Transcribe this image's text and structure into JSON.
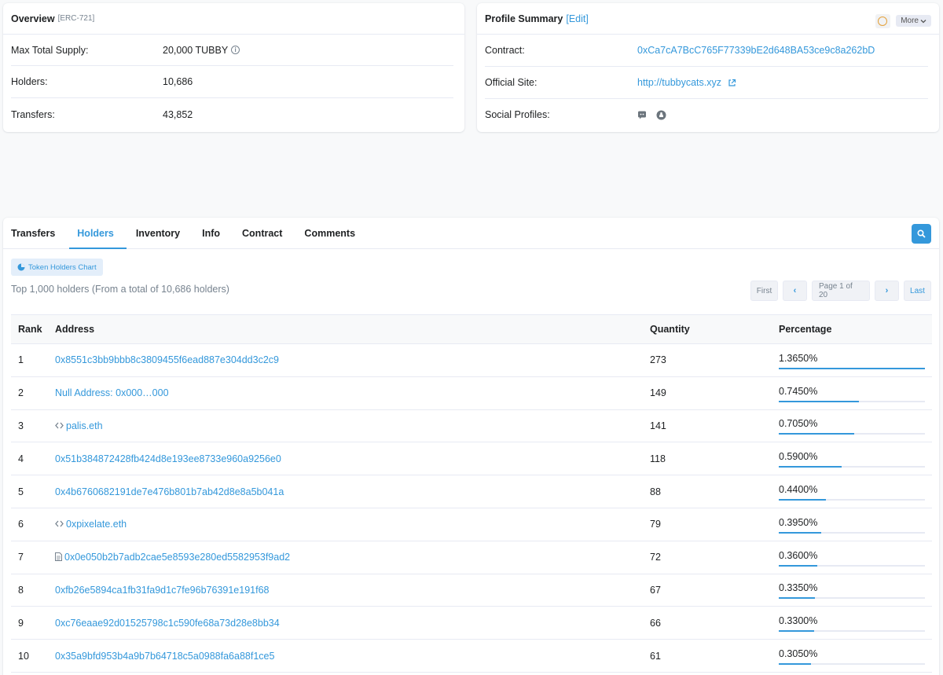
{
  "overview": {
    "title": "Overview",
    "standard": "[ERC-721]",
    "rows": [
      {
        "label": "Max Total Supply:",
        "value": "20,000 TUBBY"
      },
      {
        "label": "Holders:",
        "value": "10,686"
      },
      {
        "label": "Transfers:",
        "value": "43,852"
      }
    ]
  },
  "profile": {
    "title": "Profile Summary",
    "edit": "[Edit]",
    "more": "More",
    "rows": [
      {
        "label": "Contract:",
        "value": "0xCa7cA7BcC765F77339bE2d648BA53ce9c8a262bD"
      },
      {
        "label": "Official Site:",
        "value": "http://tubbycats.xyz"
      },
      {
        "label": "Social Profiles:",
        "value": ""
      }
    ],
    "social_icons": [
      "discord-icon",
      "github-icon"
    ]
  },
  "tabs": [
    "Transfers",
    "Holders",
    "Inventory",
    "Info",
    "Contract",
    "Comments"
  ],
  "active_tab": "Holders",
  "chart_button": "Token Holders Chart",
  "summary": "Top 1,000 holders (From a total of 10,686 holders)",
  "pager": {
    "first": "First",
    "prev": "‹",
    "page": "Page 1 of 20",
    "next": "›",
    "last": "Last"
  },
  "columns": [
    "Rank",
    "Address",
    "Quantity",
    "Percentage"
  ],
  "holders": [
    {
      "rank": "1",
      "address": "0x8551c3bb9bbb8c3809455f6ead887e304dd3c2c9",
      "icon": "",
      "qty": "273",
      "pct": "1.3650%",
      "fill": 1.0
    },
    {
      "rank": "2",
      "address": "Null Address: 0x000…000",
      "icon": "",
      "qty": "149",
      "pct": "0.7450%",
      "fill": 0.546
    },
    {
      "rank": "3",
      "address": "palis.eth",
      "icon": "ens-icon",
      "qty": "141",
      "pct": "0.7050%",
      "fill": 0.516
    },
    {
      "rank": "4",
      "address": "0x51b384872428fb424d8e193ee8733e960a9256e0",
      "icon": "",
      "qty": "118",
      "pct": "0.5900%",
      "fill": 0.432
    },
    {
      "rank": "5",
      "address": "0x4b6760682191de7e476b801b7ab42d8e8a5b041a",
      "icon": "",
      "qty": "88",
      "pct": "0.4400%",
      "fill": 0.322
    },
    {
      "rank": "6",
      "address": "0xpixelate.eth",
      "icon": "ens-icon",
      "qty": "79",
      "pct": "0.3950%",
      "fill": 0.289
    },
    {
      "rank": "7",
      "address": "0x0e050b2b7adb2cae5e8593e280ed5582953f9ad2",
      "icon": "contract-icon",
      "qty": "72",
      "pct": "0.3600%",
      "fill": 0.264
    },
    {
      "rank": "8",
      "address": "0xfb26e5894ca1fb31fa9d1c7fe96b76391e191f68",
      "icon": "",
      "qty": "67",
      "pct": "0.3350%",
      "fill": 0.245
    },
    {
      "rank": "9",
      "address": "0xc76eaae92d01525798c1c590fe68a73d28e8bb34",
      "icon": "",
      "qty": "66",
      "pct": "0.3300%",
      "fill": 0.242
    },
    {
      "rank": "10",
      "address": "0x35a9bfd953b4a9b7b64718c5a0988fa6a88f1ce5",
      "icon": "",
      "qty": "61",
      "pct": "0.3050%",
      "fill": 0.223
    }
  ]
}
